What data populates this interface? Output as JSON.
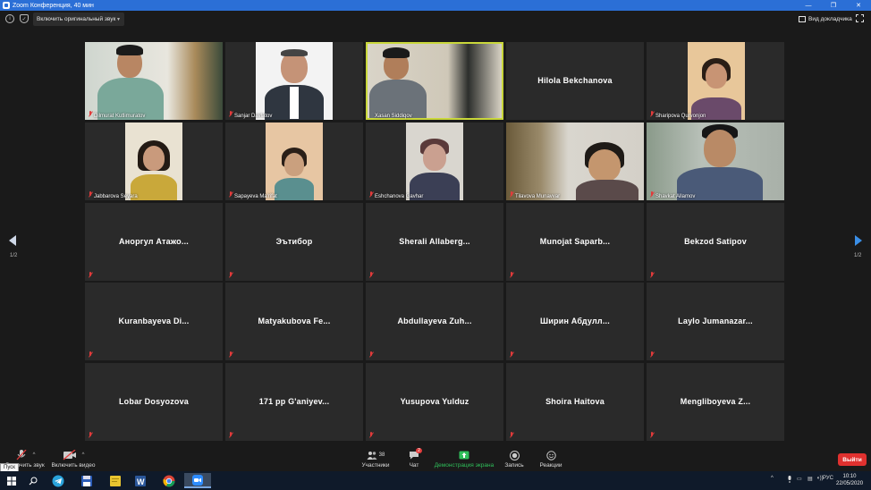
{
  "window": {
    "title": "Zoom Конференция, 40 мин"
  },
  "toolbar_top": {
    "original_sound": "Включить оригинальный звук",
    "view_mode": "Вид докладчика",
    "info_icon": "info-icon",
    "shield_icon": "shield-icon",
    "fullscreen_icon": "fullscreen-icon"
  },
  "participants": [
    {
      "name": "Dilmurat Kutlimuratov",
      "video": true
    },
    {
      "name": "Sanjar Davlatov",
      "video": true
    },
    {
      "name": "Xasan Siddiqov",
      "video": true,
      "active_speaker": true
    },
    {
      "name": "Hilola Bekchanova",
      "video": false
    },
    {
      "name": "Sharipova Qurvonjon",
      "video": true
    },
    {
      "name": "Jabbarova Seyara",
      "video": true
    },
    {
      "name": "Sapayeva Ma'rifat",
      "video": true
    },
    {
      "name": "Eshchanova Gavhar",
      "video": true
    },
    {
      "name": "Tilavova Munavvar",
      "video": true
    },
    {
      "name": "Shavkat Allamov",
      "video": true
    },
    {
      "name": "Аноргул  Атажо...",
      "video": false
    },
    {
      "name": "Эътибор",
      "video": false
    },
    {
      "name": "Sherali  Allaberg...",
      "video": false
    },
    {
      "name": "Munojat  Saparb...",
      "video": false
    },
    {
      "name": "Bekzod Satipov",
      "video": false
    },
    {
      "name": "Kuranbayeva  Di...",
      "video": false
    },
    {
      "name": "Matyakubova  Fe...",
      "video": false
    },
    {
      "name": "Abdullayeva  Zuh...",
      "video": false
    },
    {
      "name": "Ширин  Абдулл...",
      "video": false
    },
    {
      "name": "Laylo  Jumanazar...",
      "video": false
    },
    {
      "name": "Lobar Dosyozova",
      "video": false
    },
    {
      "name": "171 pp G'aniyev...",
      "video": false
    },
    {
      "name": "Yusupova Yulduz",
      "video": false
    },
    {
      "name": "Shoira Haitova",
      "video": false
    },
    {
      "name": "Mengliboyeva  Z...",
      "video": false
    }
  ],
  "pagination": {
    "left": "1/2",
    "right": "1/2"
  },
  "controls": {
    "unmute": "Включить звук",
    "start_video": "Включить видео",
    "participants": "Участники",
    "participants_count": "38",
    "chat": "Чат",
    "chat_badge": "2",
    "share": "Демонстрация экрана",
    "record": "Запись",
    "reactions": "Реакции",
    "leave": "Выйти"
  },
  "tooltip": "Пуск",
  "taskbar": {
    "lang": "РУС",
    "time": "10:10",
    "date": "22/05/2020"
  },
  "colors": {
    "titlebar": "#2b6fd6",
    "active_speaker": "#c9d73a",
    "share": "#2fbf5a",
    "leave": "#e0312f"
  }
}
